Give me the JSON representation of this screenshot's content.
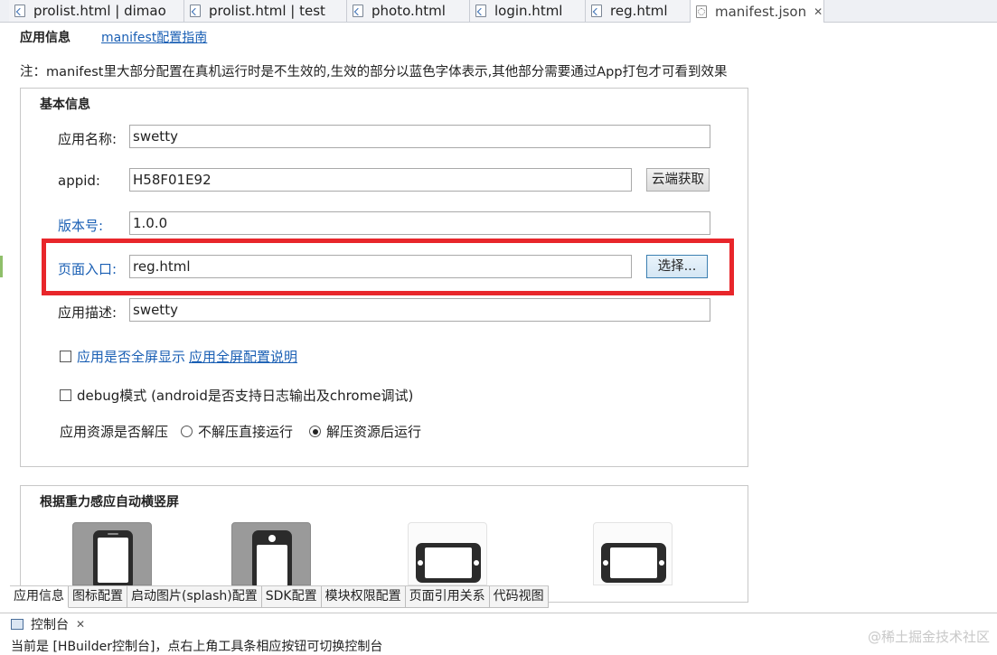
{
  "tabs": [
    {
      "label": "prolist.html | dimao",
      "active": false
    },
    {
      "label": "prolist.html | test",
      "active": false
    },
    {
      "label": "photo.html",
      "active": false
    },
    {
      "label": "login.html",
      "active": false
    },
    {
      "label": "reg.html",
      "active": false
    },
    {
      "label": "manifest.json",
      "active": true
    }
  ],
  "header": {
    "title": "应用信息",
    "guide_link": "manifest配置指南"
  },
  "notice": "注：manifest里大部分配置在真机运行时是不生效的,生效的部分以蓝色字体表示,其他部分需要通过App打包才可看到效果",
  "basic": {
    "title": "基本信息",
    "app_name_label": "应用名称:",
    "app_name_value": "swetty",
    "appid_label": "appid:",
    "appid_value": "H58F01E92",
    "cloud_button": "云端获取",
    "version_label": "版本号:",
    "version_value": "1.0.0",
    "entry_label": "页面入口:",
    "entry_value": "reg.html",
    "choose_button": "选择...",
    "desc_label": "应用描述:",
    "desc_value": "swetty",
    "fullscreen_label": "应用是否全屏显示",
    "fullscreen_link": "应用全屏配置说明",
    "debug_label": "debug模式 (android是否支持日志输出及chrome调试)",
    "unzip_label": "应用资源是否解压",
    "radio_no_unzip": "不解压直接运行",
    "radio_unzip": "解压资源后运行",
    "radio_selected": "radio_unzip"
  },
  "orientation": {
    "title": "根据重力感应自动横竖屏"
  },
  "bottom_tabs": [
    "应用信息",
    "图标配置",
    "启动图片(splash)配置",
    "SDK配置",
    "模块权限配置",
    "页面引用关系",
    "代码视图"
  ],
  "console": {
    "tab_label": "控制台",
    "message": "当前是 [HBuilder控制台]，点右上角工具条相应按钮可切换控制台"
  },
  "watermark": "@稀土掘金技术社区",
  "colors": {
    "highlight": "#e8262b",
    "link_blue": "#1a5fb4"
  }
}
